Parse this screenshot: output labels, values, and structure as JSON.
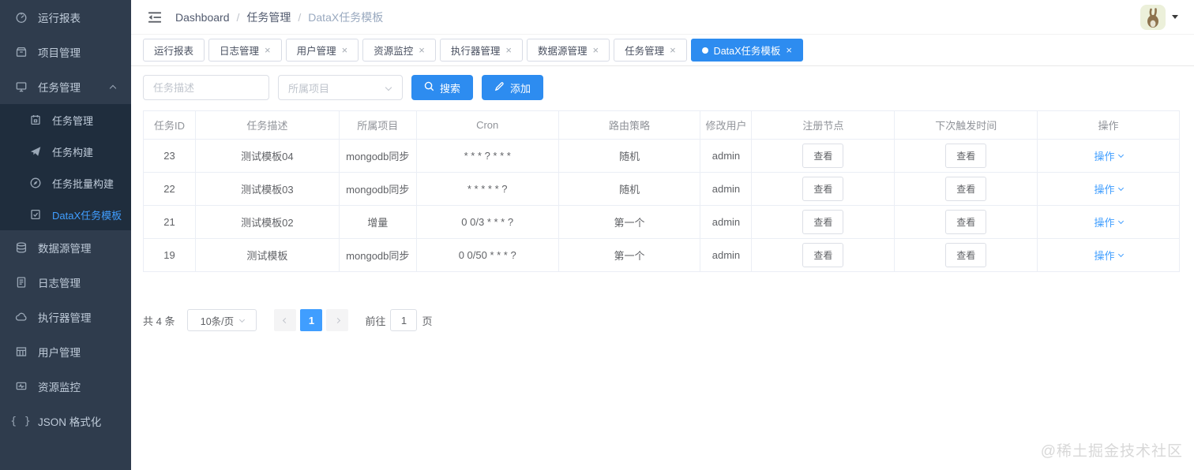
{
  "colors": {
    "primary_blue": "#2d8cf0",
    "link_blue": "#409EFF",
    "sidebar_bg": "#2f3c4d",
    "submenu_bg": "#1f2d3d",
    "sidebar_text": "#bfcbd9",
    "active_menu_text": "#409EFF",
    "table_border": "#ebeef5",
    "watermark_gray": "#d8d8d8"
  },
  "sidebar": {
    "braces_glyph": "{ }",
    "items": [
      {
        "label": "运行报表",
        "icon": "gauge-icon"
      },
      {
        "label": "项目管理",
        "icon": "project-box-icon"
      },
      {
        "label": "任务管理",
        "icon": "monitor-icon",
        "expanded": true
      },
      {
        "label": "数据源管理",
        "icon": "database-icon"
      },
      {
        "label": "日志管理",
        "icon": "log-file-icon"
      },
      {
        "label": "执行器管理",
        "icon": "cloud-icon"
      },
      {
        "label": "用户管理",
        "icon": "user-grid-icon"
      },
      {
        "label": "资源监控",
        "icon": "resource-monitor-icon"
      },
      {
        "label": "JSON 格式化",
        "icon": "braces-icon"
      }
    ],
    "task_children": [
      {
        "label": "任务管理",
        "icon": "clipboard-icon"
      },
      {
        "label": "任务构建",
        "icon": "paper-plane-icon"
      },
      {
        "label": "任务批量构建",
        "icon": "compass-icon"
      },
      {
        "label": "DataX任务模板",
        "icon": "doc-check-icon",
        "active": true
      }
    ]
  },
  "breadcrumb": {
    "separator": "/",
    "items": [
      "Dashboard",
      "任务管理",
      "DataX任务模板"
    ]
  },
  "tabs": {
    "close_glyph": "×",
    "items": [
      {
        "label": "运行报表",
        "closable": false,
        "active": false
      },
      {
        "label": "日志管理",
        "closable": true,
        "active": false
      },
      {
        "label": "用户管理",
        "closable": true,
        "active": false
      },
      {
        "label": "资源监控",
        "closable": true,
        "active": false
      },
      {
        "label": "执行器管理",
        "closable": true,
        "active": false
      },
      {
        "label": "数据源管理",
        "closable": true,
        "active": false
      },
      {
        "label": "任务管理",
        "closable": true,
        "active": false
      },
      {
        "label": "DataX任务模板",
        "closable": true,
        "active": true
      }
    ]
  },
  "toolbar": {
    "search_placeholder": "任务描述",
    "project_placeholder": "所属项目",
    "search_label": "搜索",
    "add_label": "添加"
  },
  "table": {
    "headers": [
      "任务ID",
      "任务描述",
      "所属项目",
      "Cron",
      "路由策略",
      "修改用户",
      "注册节点",
      "下次触发时间",
      "操作"
    ],
    "view_label": "查看",
    "action_label": "操作",
    "rows": [
      {
        "id": "23",
        "desc": "测试模板04",
        "project": "mongodb同步",
        "cron": "* * * ? * * *",
        "route": "随机",
        "user": "admin"
      },
      {
        "id": "22",
        "desc": "测试模板03",
        "project": "mongodb同步",
        "cron": "* * * * * ?",
        "route": "随机",
        "user": "admin"
      },
      {
        "id": "21",
        "desc": "测试模板02",
        "project": "增量",
        "cron": "0 0/3 * * * ?",
        "route": "第一个",
        "user": "admin"
      },
      {
        "id": "19",
        "desc": "测试模板",
        "project": "mongodb同步",
        "cron": "0 0/50 * * * ?",
        "route": "第一个",
        "user": "admin"
      }
    ]
  },
  "pagination": {
    "total_text": "共 4 条",
    "page_size": "10条/页",
    "current_page": "1",
    "goto_label": "前往",
    "goto_value": "1",
    "page_unit": "页"
  },
  "page": {
    "watermark": "@稀土掘金技术社区"
  }
}
